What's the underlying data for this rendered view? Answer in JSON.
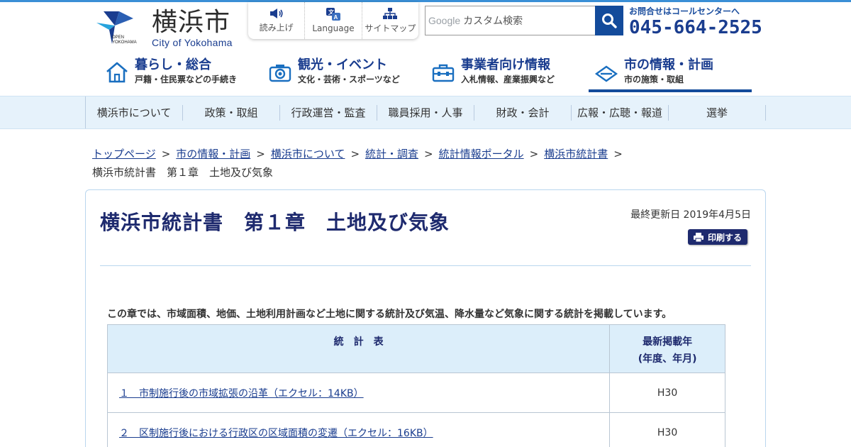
{
  "header": {
    "logo_kanji": "横浜市",
    "logo_english": "City of Yokohama",
    "logo_open": "OPEN\nYOKOHAMA",
    "utility": [
      {
        "label": "読み上げ",
        "icon": "speaker-icon"
      },
      {
        "label": "Language",
        "icon": "language-icon"
      },
      {
        "label": "サイトマップ",
        "icon": "sitemap-icon"
      }
    ],
    "search": {
      "brand": "Google",
      "placeholder": "カスタム検索"
    },
    "contact": {
      "label": "お問合せはコールセンターへ",
      "tel": "045-664-2525"
    }
  },
  "main_nav": [
    {
      "title": "暮らし・総合",
      "sub": "戸籍・住民票などの手続き",
      "icon": "house-icon"
    },
    {
      "title": "観光・イベント",
      "sub": "文化・芸術・スポーツなど",
      "icon": "camera-icon"
    },
    {
      "title": "事業者向け情報",
      "sub": "入札情報、産業振興など",
      "icon": "toolbox-icon"
    },
    {
      "title": "市の情報・計画",
      "sub": "市の施策・取組",
      "icon": "city-info-icon",
      "active": true
    }
  ],
  "sub_nav": [
    "横浜市について",
    "政策・取組",
    "行政運営・監査",
    "職員採用・人事",
    "財政・会計",
    "広報・広聴・報道",
    "選挙"
  ],
  "breadcrumb": {
    "links": [
      "トップページ",
      "市の情報・計画",
      "横浜市について",
      "統計・調査",
      "統計情報ポータル",
      "横浜市統計書"
    ],
    "separator": ">",
    "current": "横浜市統計書　第１章　土地及び気象"
  },
  "page": {
    "title": "横浜市統計書　第１章　土地及び気象",
    "updated": "最終更新日 2019年4月5日",
    "print_label": "印刷する",
    "intro": "この章では、市域面積、地価、土地利用計画など土地に関する統計及び気温、降水量など気象に関する統計を掲載しています。"
  },
  "table": {
    "headers": [
      "統　計　表",
      "最新掲載年",
      "(年度、年月)"
    ],
    "rows": [
      {
        "name": "１　市制施行後の市域拡張の沿革（エクセル：14KB）",
        "year": "H30"
      },
      {
        "name": "２　区制施行後における行政区の区域面積の変遷（エクセル：16KB）",
        "year": "H30"
      }
    ]
  },
  "colors": {
    "brand": "#1a3d8f",
    "accent": "#134b9b",
    "subnav_bg": "#e6f2fb",
    "table_head_bg": "#dceefa"
  }
}
